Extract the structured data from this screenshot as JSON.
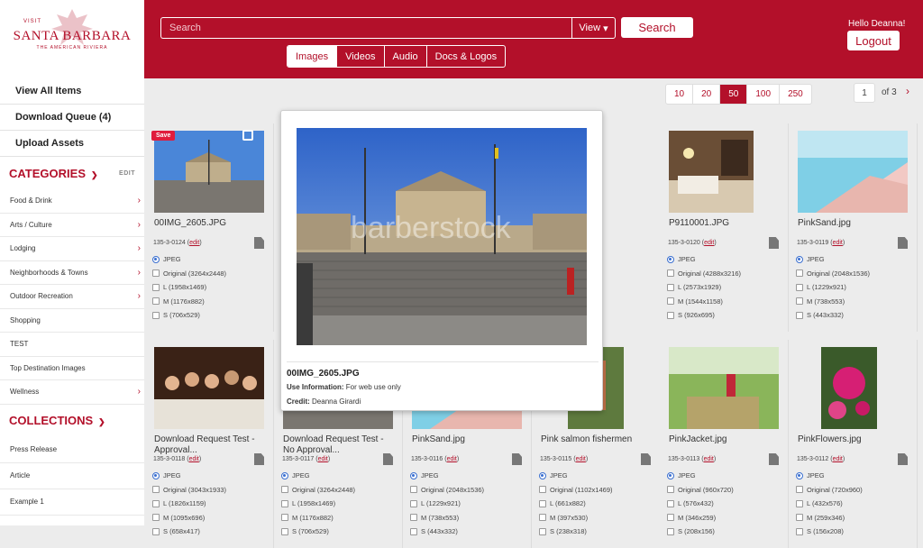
{
  "header": {
    "logo": {
      "visit": "VISIT",
      "main": "SANTA BARBARA",
      "sub": "THE AMERICAN RIVIERA"
    },
    "search_placeholder": "Search",
    "view_label": "View",
    "search_label": "Search",
    "tabs": [
      "Images",
      "Videos",
      "Audio",
      "Docs & Logos"
    ],
    "greeting": "Hello Deanna!",
    "logout_label": "Logout"
  },
  "sidebar": {
    "links": [
      "View All Items",
      "Download Queue (4)",
      "Upload Assets"
    ],
    "categories_title": "CATEGORIES",
    "edit_label": "EDIT",
    "categories": [
      {
        "label": "Food & Drink",
        "arrow": true
      },
      {
        "label": "Arts / Culture",
        "arrow": true
      },
      {
        "label": "Lodging",
        "arrow": true
      },
      {
        "label": "Neighborhoods & Towns",
        "arrow": true
      },
      {
        "label": "Outdoor Recreation",
        "arrow": true
      },
      {
        "label": "Shopping",
        "arrow": false
      },
      {
        "label": "TEST",
        "arrow": false
      },
      {
        "label": "Top Destination Images",
        "arrow": false
      },
      {
        "label": "Wellness",
        "arrow": true
      }
    ],
    "collections_title": "COLLECTIONS",
    "collections": [
      "Press Release",
      "Article",
      "Example 1"
    ]
  },
  "pager": {
    "sizes": [
      "10",
      "20",
      "50",
      "100",
      "250"
    ],
    "active_size": "50",
    "current_page": "1",
    "of_text": "of 3"
  },
  "edit_link": "edit",
  "format_label": "JPEG",
  "save_label": "Save",
  "cards": [
    {
      "name": "00IMG_2605.JPG",
      "id": "135-3-0124",
      "opts": [
        "Original (3264x2448)",
        "L (1958x1469)",
        "M (1176x882)",
        "S (706x529)"
      ]
    },
    {
      "name": "P9110001.JPG",
      "id": "135-3-0120",
      "opts": [
        "Original (4288x3216)",
        "L (2573x1929)",
        "M (1544x1158)",
        "S (926x695)"
      ]
    },
    {
      "name": "PinkSand.jpg",
      "id": "135-3-0119",
      "opts": [
        "Original (2048x1536)",
        "L (1229x921)",
        "M (738x553)",
        "S (443x332)"
      ]
    },
    {
      "name": "Download Request Test - Approval...",
      "id": "135-3-0118",
      "opts": [
        "Original (3043x1933)",
        "L (1826x1159)",
        "M (1095x696)",
        "S (658x417)"
      ]
    },
    {
      "name": "Download Request Test - No Approval...",
      "id": "135-3-0117",
      "opts": [
        "Original (3264x2448)",
        "L (1958x1469)",
        "M (1176x882)",
        "S (706x529)"
      ]
    },
    {
      "name": "PinkSand.jpg",
      "id": "135-3-0116",
      "opts": [
        "Original (2048x1536)",
        "L (1229x921)",
        "M (738x553)",
        "S (443x332)"
      ]
    },
    {
      "name": "Pink salmon fishermen",
      "id": "135-3-0115",
      "opts": [
        "Original (1102x1469)",
        "L (661x882)",
        "M (397x530)",
        "S (238x318)"
      ]
    },
    {
      "name": "PinkJacket.jpg",
      "id": "135-3-0113",
      "opts": [
        "Original (960x720)",
        "L (576x432)",
        "M (346x259)",
        "S (208x156)"
      ]
    },
    {
      "name": "PinkFlowers.jpg",
      "id": "135-3-0112",
      "opts": [
        "Original (720x960)",
        "L (432x576)",
        "M (259x346)",
        "S (156x208)"
      ]
    }
  ],
  "popup": {
    "title": "00IMG_2605.JPG",
    "use_label": "Use Information:",
    "use_value": "For web use only",
    "credit_label": "Credit:",
    "credit_value": "Deanna Girardi",
    "watermark": "barberstock"
  },
  "colors": {
    "brand": "#b3102a",
    "radio": "#3a6fd0"
  }
}
